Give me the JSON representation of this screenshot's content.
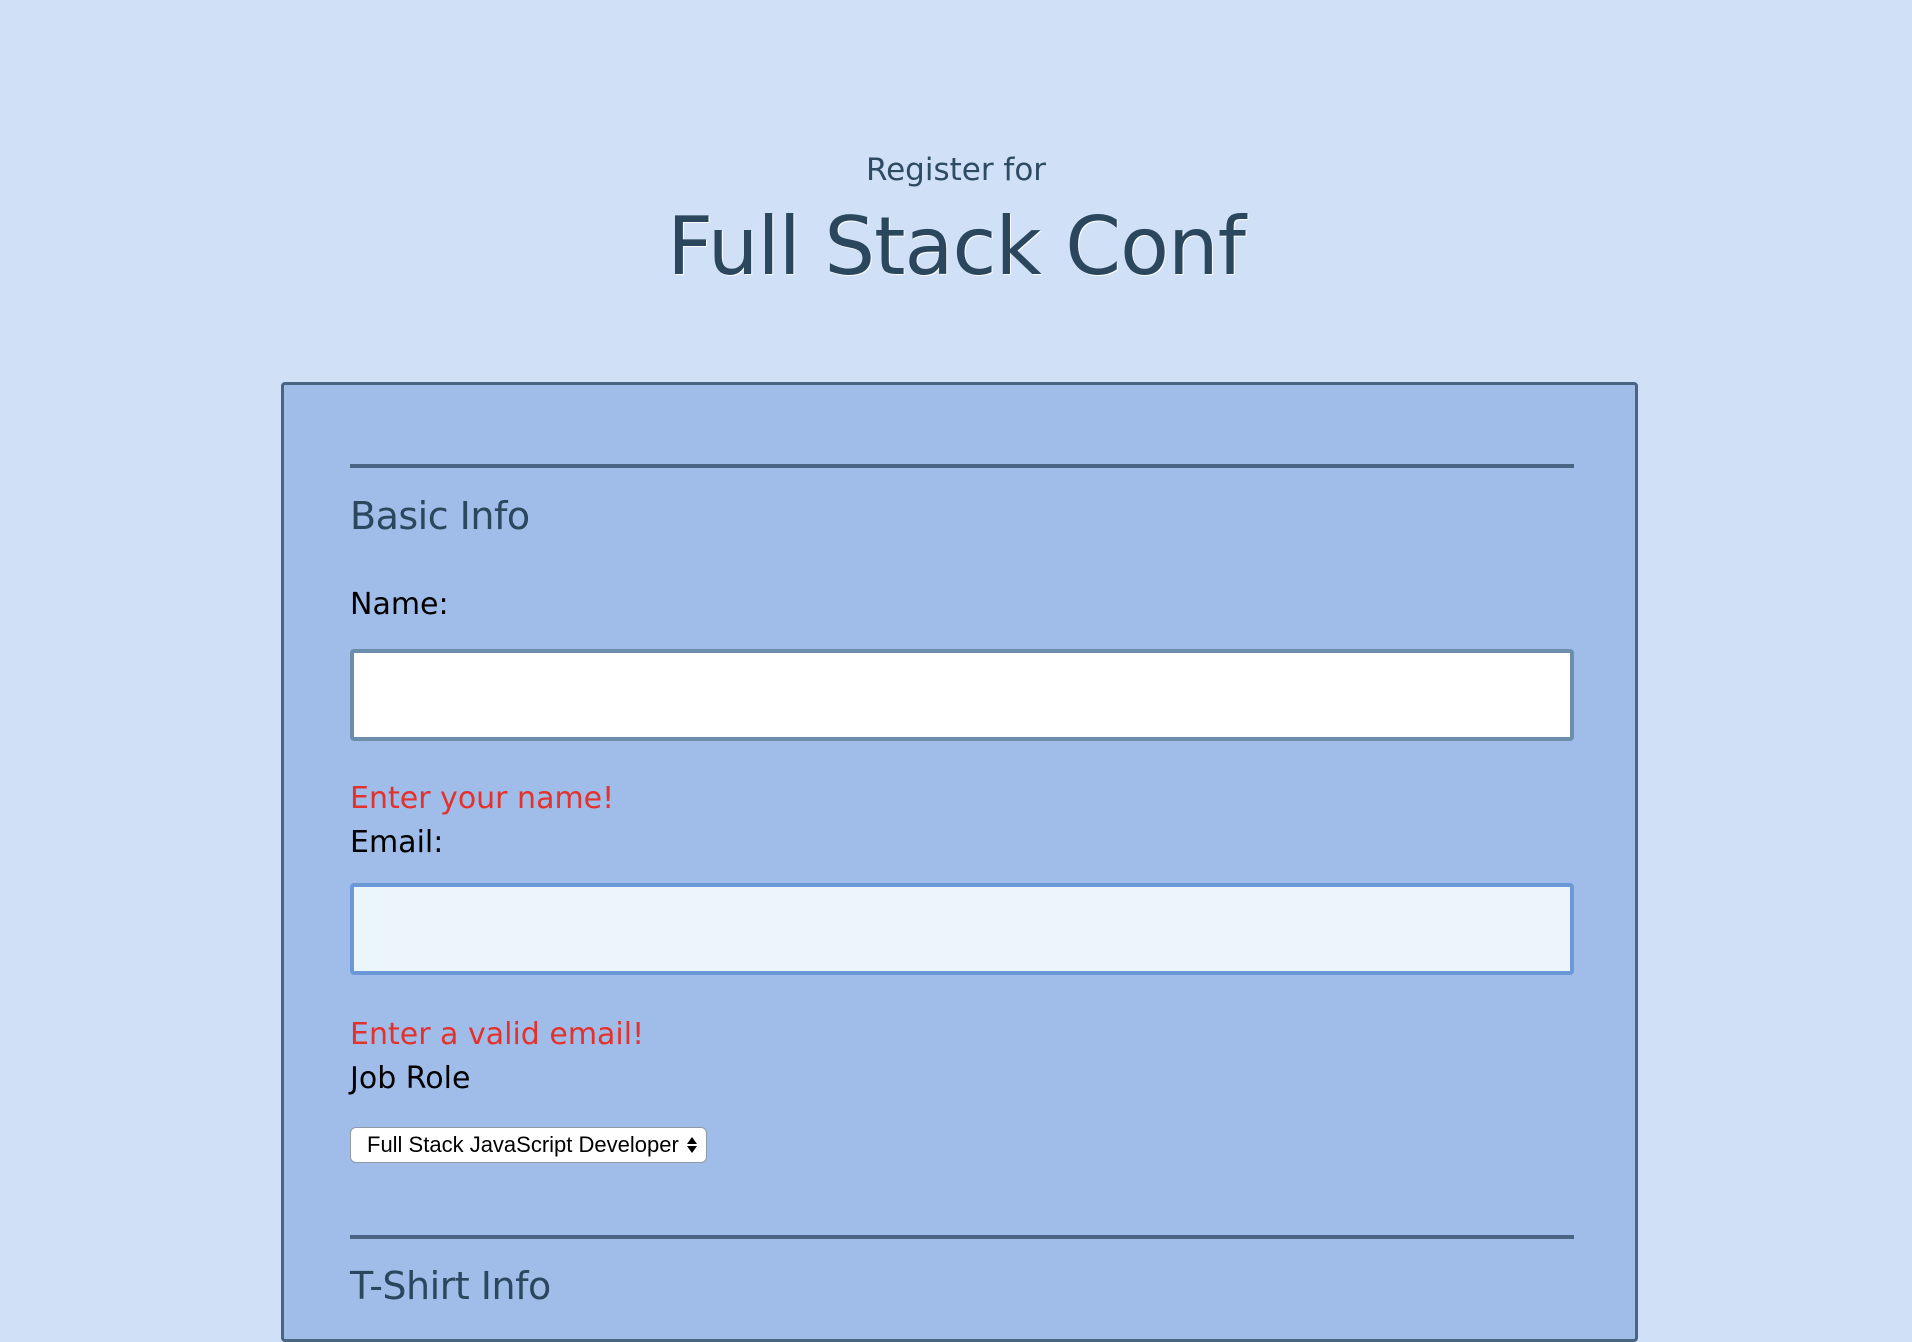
{
  "header": {
    "subtitle": "Register for",
    "title": "Full Stack Conf"
  },
  "basic_info": {
    "section_title": "Basic Info",
    "name_label": "Name:",
    "name_value": "",
    "name_error": "Enter your name!",
    "email_label": "Email:",
    "email_value": "",
    "email_error": "Enter a valid email!",
    "job_role_label": "Job Role",
    "job_role_selected": "Full Stack JavaScript Developer"
  },
  "tshirt_info": {
    "section_title": "T-Shirt Info"
  },
  "colors": {
    "page_background": "#d0e0f7",
    "form_background": "#a0bde9",
    "heading_color": "#2a475d",
    "error_color": "#e3322d",
    "focused_input_background": "#ebf5fa"
  }
}
